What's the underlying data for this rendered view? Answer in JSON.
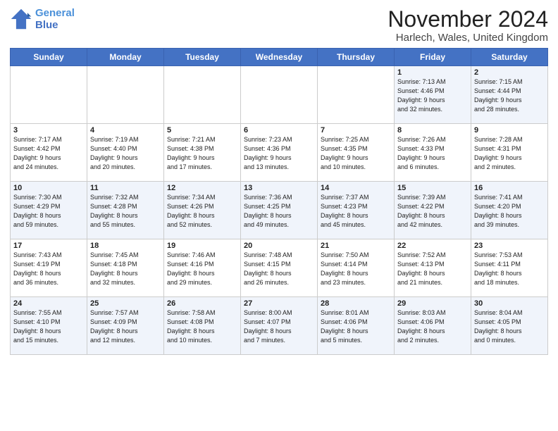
{
  "logo": {
    "line1": "General",
    "line2": "Blue"
  },
  "header": {
    "month": "November 2024",
    "location": "Harlech, Wales, United Kingdom"
  },
  "weekdays": [
    "Sunday",
    "Monday",
    "Tuesday",
    "Wednesday",
    "Thursday",
    "Friday",
    "Saturday"
  ],
  "weeks": [
    [
      {
        "day": "",
        "info": ""
      },
      {
        "day": "",
        "info": ""
      },
      {
        "day": "",
        "info": ""
      },
      {
        "day": "",
        "info": ""
      },
      {
        "day": "",
        "info": ""
      },
      {
        "day": "1",
        "info": "Sunrise: 7:13 AM\nSunset: 4:46 PM\nDaylight: 9 hours\nand 32 minutes."
      },
      {
        "day": "2",
        "info": "Sunrise: 7:15 AM\nSunset: 4:44 PM\nDaylight: 9 hours\nand 28 minutes."
      }
    ],
    [
      {
        "day": "3",
        "info": "Sunrise: 7:17 AM\nSunset: 4:42 PM\nDaylight: 9 hours\nand 24 minutes."
      },
      {
        "day": "4",
        "info": "Sunrise: 7:19 AM\nSunset: 4:40 PM\nDaylight: 9 hours\nand 20 minutes."
      },
      {
        "day": "5",
        "info": "Sunrise: 7:21 AM\nSunset: 4:38 PM\nDaylight: 9 hours\nand 17 minutes."
      },
      {
        "day": "6",
        "info": "Sunrise: 7:23 AM\nSunset: 4:36 PM\nDaylight: 9 hours\nand 13 minutes."
      },
      {
        "day": "7",
        "info": "Sunrise: 7:25 AM\nSunset: 4:35 PM\nDaylight: 9 hours\nand 10 minutes."
      },
      {
        "day": "8",
        "info": "Sunrise: 7:26 AM\nSunset: 4:33 PM\nDaylight: 9 hours\nand 6 minutes."
      },
      {
        "day": "9",
        "info": "Sunrise: 7:28 AM\nSunset: 4:31 PM\nDaylight: 9 hours\nand 2 minutes."
      }
    ],
    [
      {
        "day": "10",
        "info": "Sunrise: 7:30 AM\nSunset: 4:29 PM\nDaylight: 8 hours\nand 59 minutes."
      },
      {
        "day": "11",
        "info": "Sunrise: 7:32 AM\nSunset: 4:28 PM\nDaylight: 8 hours\nand 55 minutes."
      },
      {
        "day": "12",
        "info": "Sunrise: 7:34 AM\nSunset: 4:26 PM\nDaylight: 8 hours\nand 52 minutes."
      },
      {
        "day": "13",
        "info": "Sunrise: 7:36 AM\nSunset: 4:25 PM\nDaylight: 8 hours\nand 49 minutes."
      },
      {
        "day": "14",
        "info": "Sunrise: 7:37 AM\nSunset: 4:23 PM\nDaylight: 8 hours\nand 45 minutes."
      },
      {
        "day": "15",
        "info": "Sunrise: 7:39 AM\nSunset: 4:22 PM\nDaylight: 8 hours\nand 42 minutes."
      },
      {
        "day": "16",
        "info": "Sunrise: 7:41 AM\nSunset: 4:20 PM\nDaylight: 8 hours\nand 39 minutes."
      }
    ],
    [
      {
        "day": "17",
        "info": "Sunrise: 7:43 AM\nSunset: 4:19 PM\nDaylight: 8 hours\nand 36 minutes."
      },
      {
        "day": "18",
        "info": "Sunrise: 7:45 AM\nSunset: 4:18 PM\nDaylight: 8 hours\nand 32 minutes."
      },
      {
        "day": "19",
        "info": "Sunrise: 7:46 AM\nSunset: 4:16 PM\nDaylight: 8 hours\nand 29 minutes."
      },
      {
        "day": "20",
        "info": "Sunrise: 7:48 AM\nSunset: 4:15 PM\nDaylight: 8 hours\nand 26 minutes."
      },
      {
        "day": "21",
        "info": "Sunrise: 7:50 AM\nSunset: 4:14 PM\nDaylight: 8 hours\nand 23 minutes."
      },
      {
        "day": "22",
        "info": "Sunrise: 7:52 AM\nSunset: 4:13 PM\nDaylight: 8 hours\nand 21 minutes."
      },
      {
        "day": "23",
        "info": "Sunrise: 7:53 AM\nSunset: 4:11 PM\nDaylight: 8 hours\nand 18 minutes."
      }
    ],
    [
      {
        "day": "24",
        "info": "Sunrise: 7:55 AM\nSunset: 4:10 PM\nDaylight: 8 hours\nand 15 minutes."
      },
      {
        "day": "25",
        "info": "Sunrise: 7:57 AM\nSunset: 4:09 PM\nDaylight: 8 hours\nand 12 minutes."
      },
      {
        "day": "26",
        "info": "Sunrise: 7:58 AM\nSunset: 4:08 PM\nDaylight: 8 hours\nand 10 minutes."
      },
      {
        "day": "27",
        "info": "Sunrise: 8:00 AM\nSunset: 4:07 PM\nDaylight: 8 hours\nand 7 minutes."
      },
      {
        "day": "28",
        "info": "Sunrise: 8:01 AM\nSunset: 4:06 PM\nDaylight: 8 hours\nand 5 minutes."
      },
      {
        "day": "29",
        "info": "Sunrise: 8:03 AM\nSunset: 4:06 PM\nDaylight: 8 hours\nand 2 minutes."
      },
      {
        "day": "30",
        "info": "Sunrise: 8:04 AM\nSunset: 4:05 PM\nDaylight: 8 hours\nand 0 minutes."
      }
    ]
  ]
}
